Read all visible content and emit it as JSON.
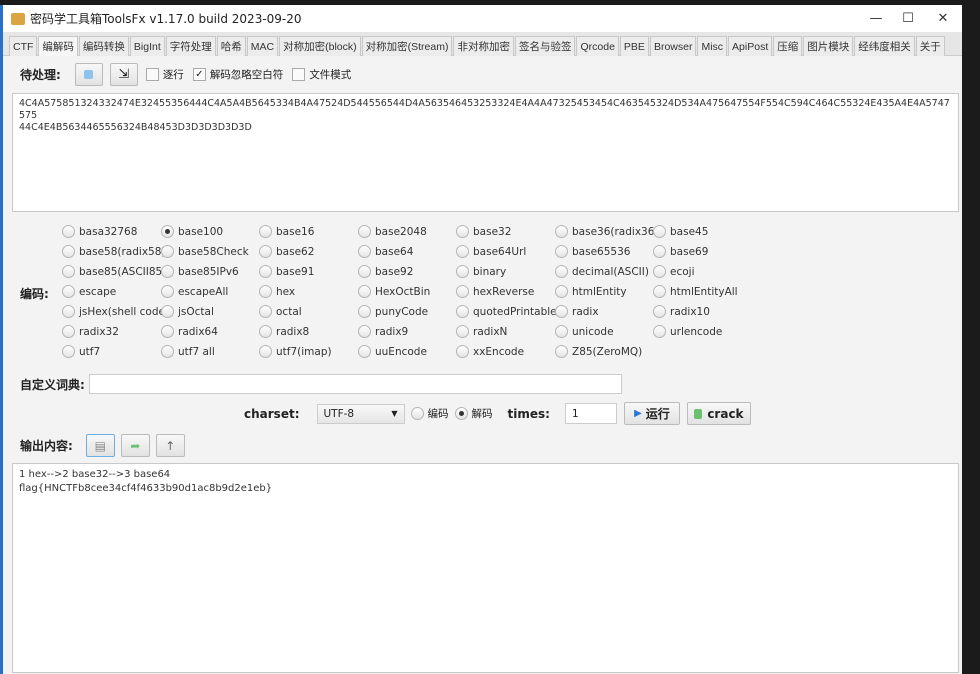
{
  "window": {
    "title": "密码学工具箱ToolsFx v1.17.0 build 2023-09-20",
    "minimize": "—",
    "maximize": "☐",
    "close": "✕"
  },
  "tabs": [
    "CTF",
    "编解码",
    "编码转换",
    "BigInt",
    "字符处理",
    "哈希",
    "MAC",
    "对称加密(block)",
    "对称加密(Stream)",
    "非对称加密",
    "签名与验签",
    "Qrcode",
    "PBE",
    "Browser",
    "Misc",
    "ApiPost",
    "压缩",
    "图片模块",
    "经纬度相关",
    "关于"
  ],
  "active_tab": "编解码",
  "input_section": {
    "label": "待处理:",
    "checkboxes": [
      {
        "label": "逐行",
        "checked": false
      },
      {
        "label": "解码忽略空白符",
        "checked": true
      },
      {
        "label": "文件模式",
        "checked": false
      }
    ],
    "value": "4C4A575851324332474E32455356444C4A5A4B5645334B4A47524D544556544D4A563546453253324E4A4A47325453454C463545324D534A475647554F554C594C464C55324E435A4E4A5747575\n44C4E4B5634465556324B48453D3D3D3D3D3D"
  },
  "encoding": {
    "label": "编码:",
    "selected": "base100",
    "options": [
      [
        "basa32768",
        "base100",
        "base16",
        "base2048",
        "base32",
        "base36(radix36)",
        "base45"
      ],
      [
        "base58(radix58)",
        "base58Check",
        "base62",
        "base64",
        "base64Url",
        "base65536",
        "base69"
      ],
      [
        "base85(ASCII85)",
        "base85IPv6",
        "base91",
        "base92",
        "binary",
        "decimal(ASCII)",
        "ecoji"
      ],
      [
        "escape",
        "escapeAll",
        "hex",
        "HexOctBin",
        "hexReverse",
        "htmlEntity",
        "htmlEntityAll"
      ],
      [
        "jsHex(shell code)",
        "jsOctal",
        "octal",
        "punyCode",
        "quotedPrintable",
        "radix",
        "radix10"
      ],
      [
        "radix32",
        "radix64",
        "radix8",
        "radix9",
        "radixN",
        "unicode",
        "urlencode"
      ],
      [
        "utf7",
        "utf7 all",
        "utf7(imap)",
        "uuEncode",
        "xxEncode",
        "Z85(ZeroMQ)"
      ]
    ]
  },
  "custom_dict": {
    "label": "自定义词典:",
    "value": ""
  },
  "controls": {
    "charset_label": "charset:",
    "charset": "UTF-8",
    "encode_label": "编码",
    "decode_label": "解码",
    "mode": "解码",
    "times_label": "times:",
    "times": "1",
    "run_label": "运行",
    "crack_label": "crack"
  },
  "output": {
    "label": "输出内容:",
    "value": "1 hex-->2 base32-->3 base64\nflag{HNCTFb8cee34cf4f4633b90d1ac8b9d2e1eb}"
  }
}
